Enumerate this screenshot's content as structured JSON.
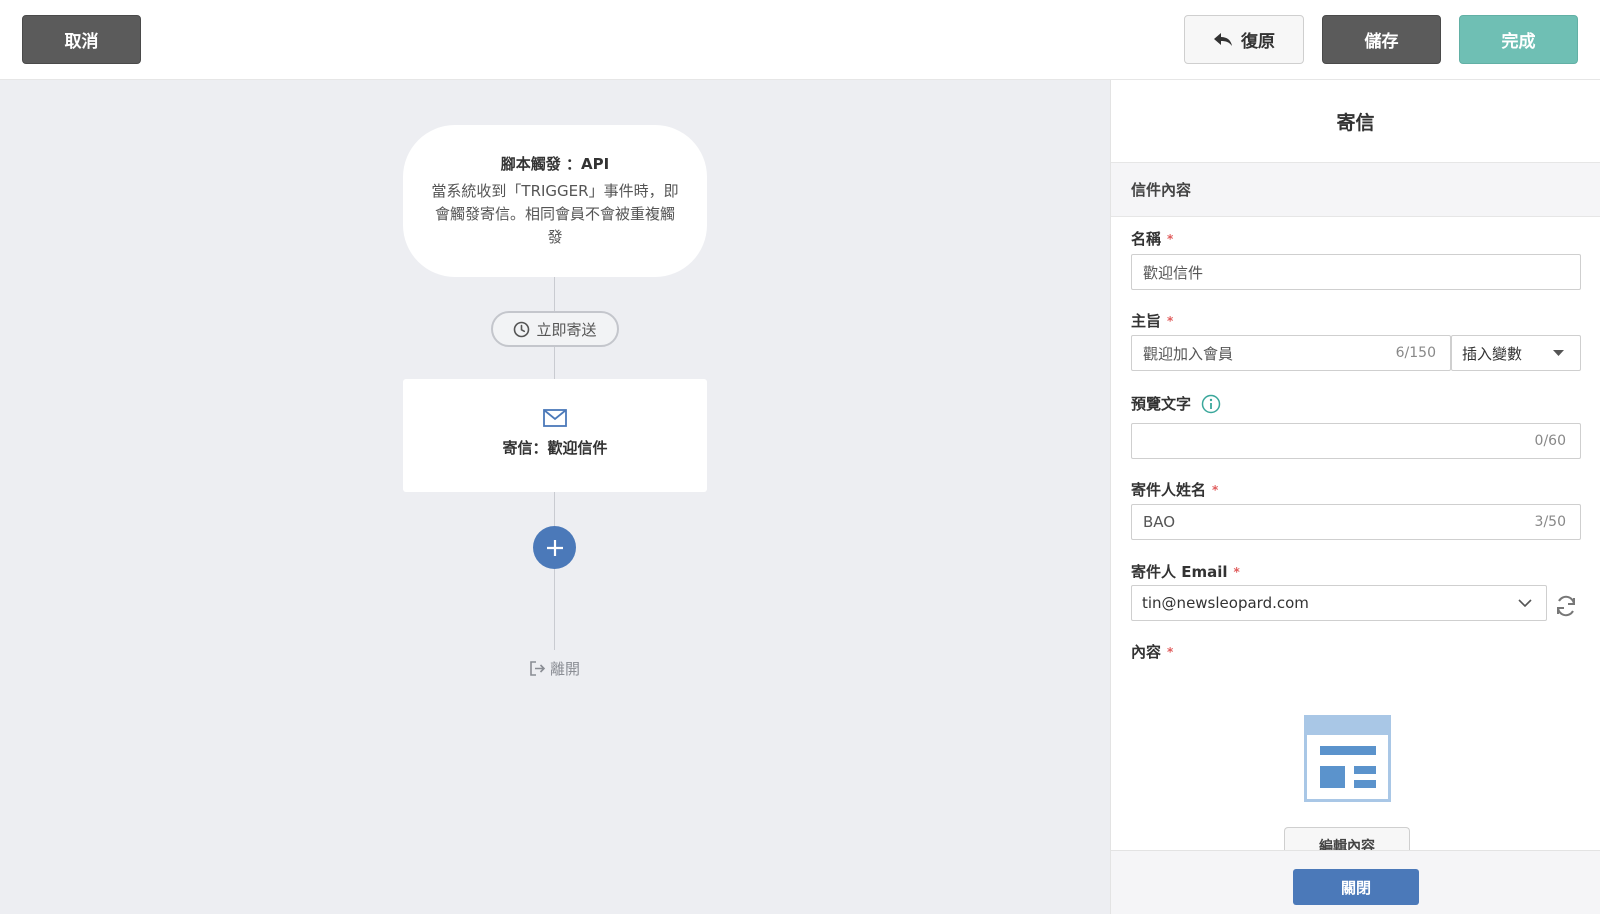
{
  "toolbar": {
    "cancel_label": "取消",
    "undo_label": "復原",
    "save_label": "儲存",
    "done_label": "完成"
  },
  "flow": {
    "trigger": {
      "title": "腳本觸發 ：API",
      "description": "當系統收到「TRIGGER」事件時，即會觸發寄信。相同會員不會被重複觸發"
    },
    "delay_label": "立即寄送",
    "email_node_label": "寄信：歡迎信件",
    "exit_label": "離開"
  },
  "panel": {
    "title": "寄信",
    "section_title": "信件內容",
    "name": {
      "label": "名稱",
      "required_mark": "*",
      "value": "歡迎信件"
    },
    "subject": {
      "label": "主旨",
      "required_mark": "*",
      "value": "觀迎加入會員",
      "counter": "6/150",
      "insert_variable": "插入變數"
    },
    "preview": {
      "label": "預覽文字",
      "value": "",
      "counter": "0/60"
    },
    "sender_name": {
      "label": "寄件人姓名",
      "required_mark": "*",
      "value": "BAO",
      "counter": "3/50"
    },
    "sender_email": {
      "label": "寄件人 Email",
      "required_mark": "*",
      "value": "tin@newsleopard.com"
    },
    "content": {
      "label": "內容",
      "required_mark": "*",
      "edit_label": "編輯內容"
    },
    "close_label": "關閉"
  },
  "colors": {
    "primary_blue": "#4b79b9",
    "done_teal": "#6fbfb4",
    "dark_button": "#5b5b5b",
    "canvas_bg": "#edeef2",
    "info_teal": "#3aa79b",
    "required_red": "#e05c5c"
  }
}
